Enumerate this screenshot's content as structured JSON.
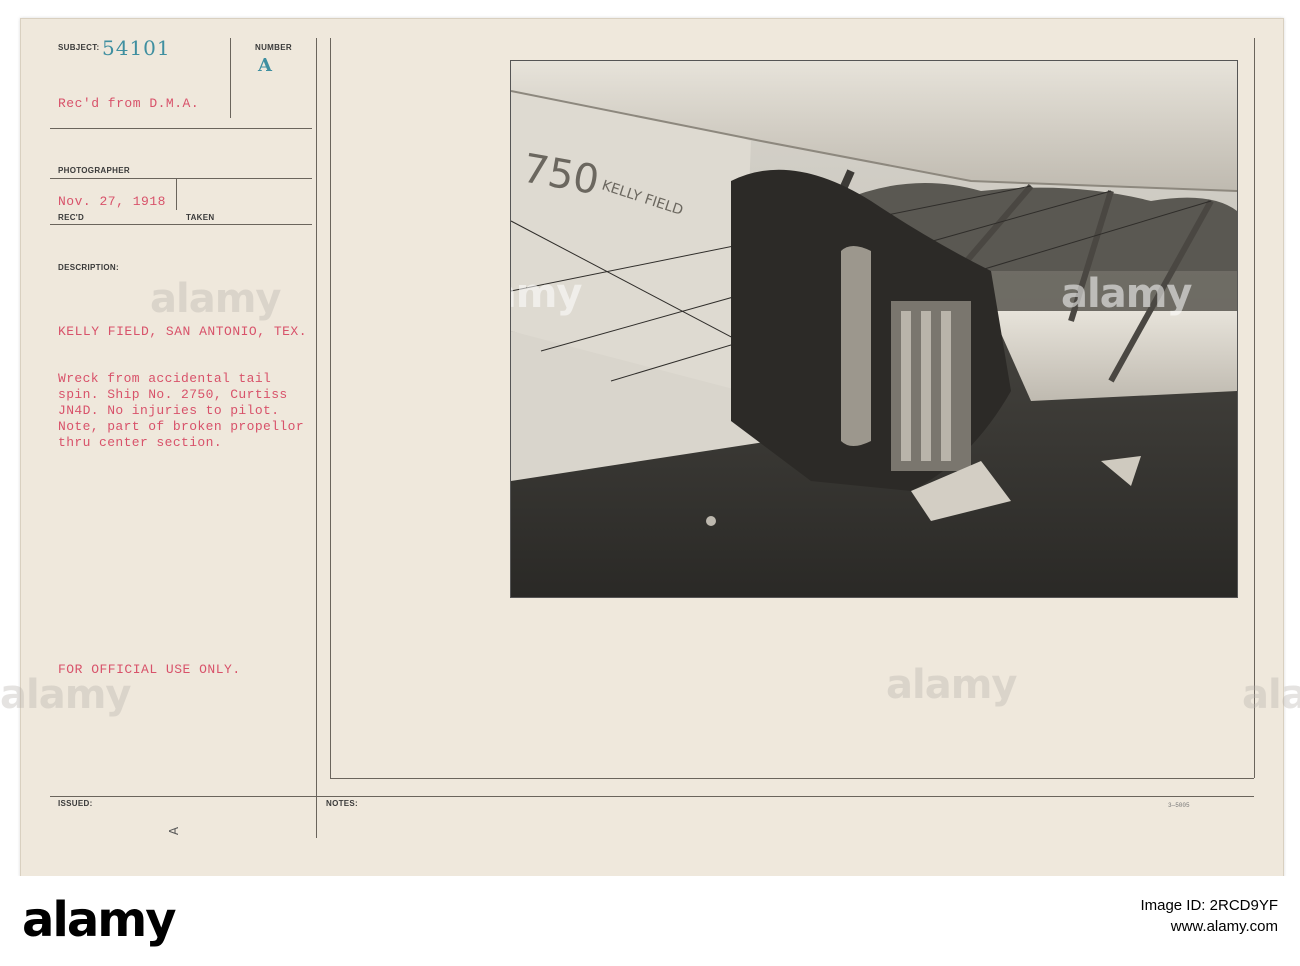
{
  "card": {
    "subject_label": "SUBJECT:",
    "subject_number": "54101",
    "number_label": "NUMBER",
    "number_value": "A",
    "received_from": "Rec'd from D.M.A.",
    "photographer_label": "PHOTOGRAPHER",
    "date_received": "Nov. 27, 1918",
    "recd_label": "REC'D",
    "taken_label": "TAKEN",
    "description_label": "DESCRIPTION:",
    "location": "KELLY FIELD, SAN ANTONIO, TEX.",
    "description_lines": [
      "Wreck from accidental tail",
      "spin. Ship No. 2750, Curtiss",
      "JN4D. No injuries to pilot.",
      "Note, part of broken propellor",
      "thru center section."
    ],
    "official_use": "FOR OFFICIAL USE ONLY.",
    "issued_label": "ISSUED:",
    "notes_label": "NOTES:",
    "issued_mark": "A",
    "form_code": "3—5005"
  },
  "photo": {
    "plane_number": "750",
    "plane_text": "KELLY FIELD"
  },
  "watermarks": [
    "alamy",
    "alamy",
    "alamy",
    "alamy",
    "alamy",
    "alamy"
  ],
  "footer": {
    "logo": "alamy",
    "image_id_line": "Image ID: 2RCD9YF",
    "site": "www.alamy.com"
  }
}
